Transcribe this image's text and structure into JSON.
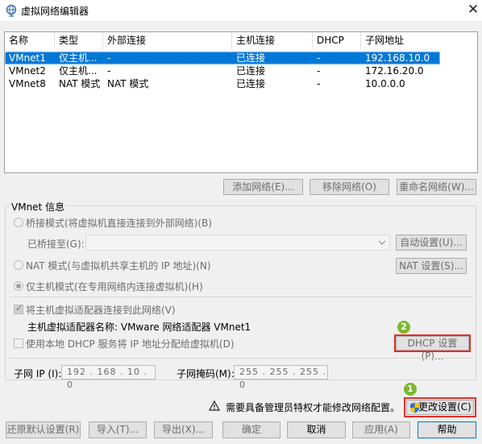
{
  "window": {
    "title": "虚拟网络编辑器",
    "close": "✕"
  },
  "table": {
    "columns": [
      "名称",
      "类型",
      "外部连接",
      "主机连接",
      "DHCP",
      "子网地址"
    ],
    "rows": [
      [
        "VMnet1",
        "仅主机...",
        "-",
        "已连接",
        "-",
        "192.168.10.0"
      ],
      [
        "VMnet2",
        "仅主机...",
        "-",
        "已连接",
        "-",
        "172.16.20.0"
      ],
      [
        "VMnet8",
        "NAT 模式",
        "NAT 模式",
        "已连接",
        "-",
        "10.0.0.0"
      ]
    ]
  },
  "list_buttons": {
    "add": "添加网络(E)...",
    "remove": "移除网络(O)",
    "rename": "重命名网络(W)..."
  },
  "vmnet_info": {
    "label": "VMnet 信息",
    "bridge_mode": "桥接模式(将虚拟机直接连接到外部网络)(B)",
    "bridged_to": "已桥接至(G):",
    "auto_settings": "自动设置(U)...",
    "nat_mode": "NAT 模式(与虚拟机共享主机的 IP 地址)(N)",
    "nat_settings": "NAT 设置(S)...",
    "host_only": "仅主机模式(在专用网络内连接虚拟机)(H)",
    "connect_adapter": "将主机虚拟适配器连接到此网络(V)",
    "adapter_name": "主机虚拟适配器名称: VMware 网络适配器 VMnet1",
    "use_dhcp": "使用本地 DHCP 服务将 IP 地址分配给虚拟机(D)",
    "dhcp_settings": "DHCP 设置(P)...",
    "subnet_ip_label": "子网 IP (I):",
    "subnet_ip": "192 . 168 . 10 . 0",
    "subnet_mask_label": "子网掩码(M):",
    "subnet_mask": "255 . 255 . 255 . 0"
  },
  "admin_notice": "需要具备管理员特权才能修改网络配置。",
  "change_settings": "更改设置(C)",
  "badges": {
    "one": "1",
    "two": "2"
  },
  "footer": {
    "restore": "还原默认设置(R)",
    "import": "导入(T)...",
    "export": "导出(X)...",
    "ok": "确定",
    "cancel": "取消",
    "apply": "应用(A)",
    "help": "帮助"
  },
  "colors": {
    "selection": "#0078d7",
    "highlight": "#e0302a",
    "badge": "#7cb82f"
  }
}
